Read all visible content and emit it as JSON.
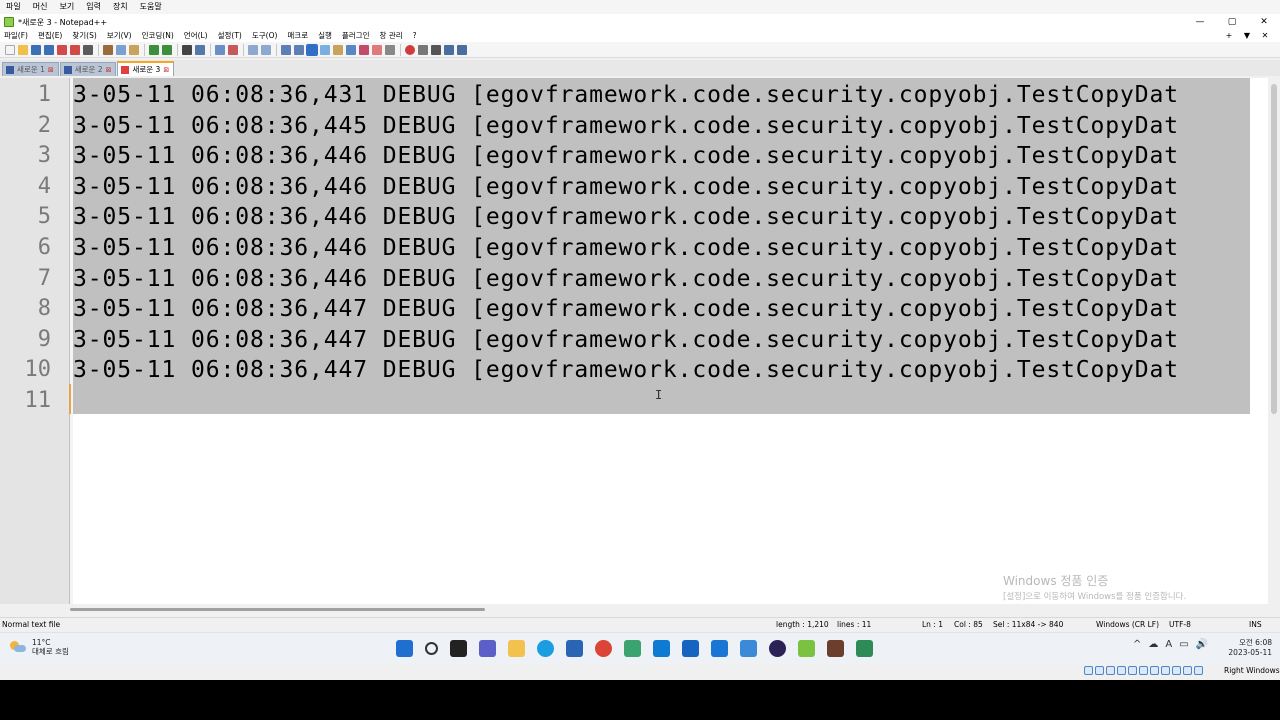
{
  "host_menu": [
    "파일",
    "머신",
    "보기",
    "입력",
    "장치",
    "도움말"
  ],
  "window": {
    "title": "*새로운 3 - Notepad++",
    "controls": [
      "—",
      "▢",
      "✕"
    ]
  },
  "menu": [
    "파일(F)",
    "편집(E)",
    "찾기(S)",
    "보기(V)",
    "인코딩(N)",
    "언어(L)",
    "설정(T)",
    "도구(O)",
    "매크로",
    "실행",
    "플러그인",
    "창 관리",
    "?"
  ],
  "menu_right": [
    "+",
    "▼",
    "✕"
  ],
  "tabs": [
    {
      "label": "새로운 1",
      "active": false
    },
    {
      "label": "새로운 2",
      "active": false
    },
    {
      "label": "새로운 3",
      "active": true
    }
  ],
  "editor": {
    "line_numbers": [
      "1",
      "2",
      "3",
      "4",
      "5",
      "6",
      "7",
      "8",
      "9",
      "10",
      "11"
    ],
    "lines": [
      "3-05-11 06:08:36,431 DEBUG [egovframework.code.security.copyobj.TestCopyDat",
      "3-05-11 06:08:36,445 DEBUG [egovframework.code.security.copyobj.TestCopyDat",
      "3-05-11 06:08:36,446 DEBUG [egovframework.code.security.copyobj.TestCopyDat",
      "3-05-11 06:08:36,446 DEBUG [egovframework.code.security.copyobj.TestCopyDat",
      "3-05-11 06:08:36,446 DEBUG [egovframework.code.security.copyobj.TestCopyDat",
      "3-05-11 06:08:36,446 DEBUG [egovframework.code.security.copyobj.TestCopyDat",
      "3-05-11 06:08:36,446 DEBUG [egovframework.code.security.copyobj.TestCopyDat",
      "3-05-11 06:08:36,447 DEBUG [egovframework.code.security.copyobj.TestCopyDat",
      "3-05-11 06:08:36,447 DEBUG [egovframework.code.security.copyobj.TestCopyDat",
      "3-05-11 06:08:36,447 DEBUG [egovframework.code.security.copyobj.TestCopyDat",
      ""
    ]
  },
  "watermark": {
    "title": "Windows 정품 인증",
    "subtitle": "[설정]으로 이동하여 Windows를 정품 인증합니다."
  },
  "status": {
    "file_type": "Normal text file",
    "length": "length : 1,210",
    "lines": "lines : 11",
    "ln": "Ln : 1",
    "col": "Col : 85",
    "sel": "Sel : 11x84 -> 840",
    "eol": "Windows (CR LF)",
    "encoding": "UTF-8",
    "mode": "INS"
  },
  "taskbar": {
    "weather_temp": "11°C",
    "weather_desc": "대체로 흐림",
    "apps": [
      {
        "name": "windows-start-icon",
        "color": "#1f6fd1"
      },
      {
        "name": "search-icon",
        "color": "#333333"
      },
      {
        "name": "taskview-icon",
        "color": "#222222"
      },
      {
        "name": "chat-icon",
        "color": "#5b5fc7"
      },
      {
        "name": "file-explorer-icon",
        "color": "#f2c14e"
      },
      {
        "name": "edge-icon",
        "color": "#1b9de2"
      },
      {
        "name": "store-icon",
        "color": "#2a64b4"
      },
      {
        "name": "chrome-icon",
        "color": "#db4437"
      },
      {
        "name": "paint-icon",
        "color": "#3aa36f"
      },
      {
        "name": "vscode-icon",
        "color": "#0e7ad1"
      },
      {
        "name": "maps-icon",
        "color": "#1565c0"
      },
      {
        "name": "pin-app-icon",
        "color": "#1976d2"
      },
      {
        "name": "window-app-icon",
        "color": "#3a8ad8"
      },
      {
        "name": "eclipse-icon",
        "color": "#2c2255"
      },
      {
        "name": "notepadpp-icon",
        "color": "#7cc242"
      },
      {
        "name": "settings-app-icon",
        "color": "#6b3f2b"
      },
      {
        "name": "paint-palette-icon",
        "color": "#2e8b57"
      }
    ],
    "tray": [
      "^",
      "☁",
      "A",
      "▭",
      "🔊"
    ],
    "time": "오전 6:08",
    "date": "2023-05-11"
  },
  "host_bar": {
    "host_key": "Right Windows"
  }
}
